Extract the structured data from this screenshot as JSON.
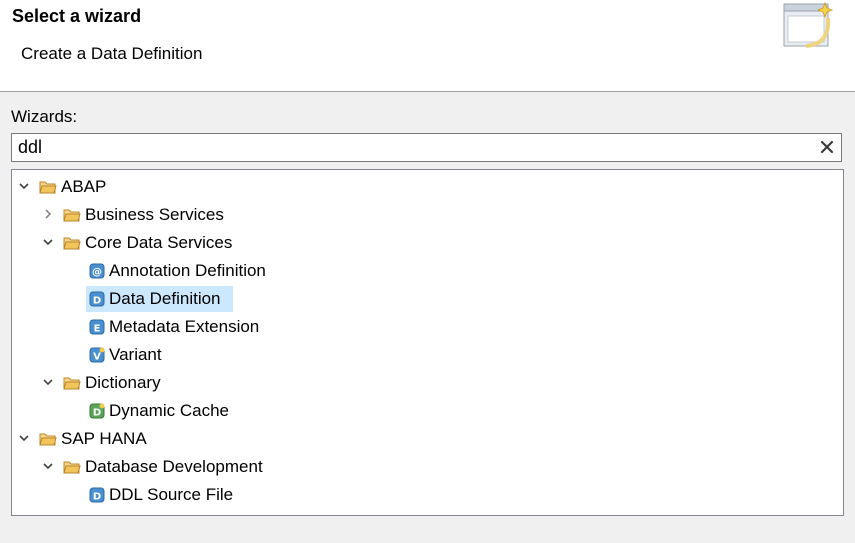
{
  "header": {
    "title": "Select a wizard",
    "description": "Create a Data Definition"
  },
  "wizards_label": "Wizards:",
  "filter": {
    "value": "ddl",
    "clear_icon": "close-icon"
  },
  "tree": {
    "abap": {
      "label": "ABAP",
      "expanded": true
    },
    "business_services": {
      "label": "Business Services",
      "expanded": false
    },
    "core_data_services": {
      "label": "Core Data Services",
      "expanded": true
    },
    "annotation_definition": {
      "label": "Annotation Definition",
      "icon": "annotation-definition-icon"
    },
    "data_definition": {
      "label": "Data Definition",
      "icon": "data-definition-icon",
      "selected": true
    },
    "metadata_extension": {
      "label": "Metadata Extension",
      "icon": "metadata-extension-icon"
    },
    "variant": {
      "label": "Variant",
      "icon": "variant-icon"
    },
    "dictionary": {
      "label": "Dictionary",
      "expanded": true
    },
    "dynamic_cache": {
      "label": "Dynamic Cache",
      "icon": "dynamic-cache-icon"
    },
    "sap_hana": {
      "label": "SAP HANA",
      "expanded": true
    },
    "database_development": {
      "label": "Database Development",
      "expanded": true
    },
    "ddl_source_file": {
      "label": "DDL Source File",
      "icon": "ddl-source-file-icon"
    }
  },
  "colors": {
    "selection": "#cce8ff",
    "folder": "#e8b85a",
    "item_icon": "#3a86c8",
    "dynamic_cache_icon": "#4a9a4a"
  }
}
